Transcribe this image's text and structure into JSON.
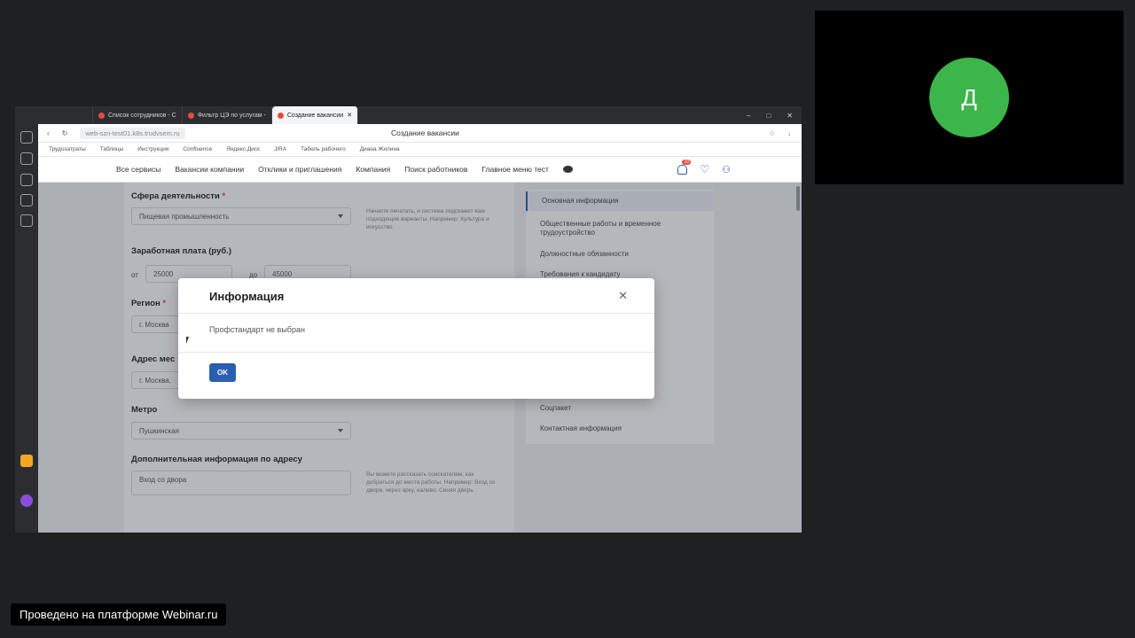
{
  "browser": {
    "tabs": [
      {
        "label": "Список сотрудников - С"
      },
      {
        "label": "Фильтр ЦЭ по услугам -"
      },
      {
        "label": "Создание вакансии",
        "active": true
      }
    ],
    "url": "web-szn-test01.k8s.trudvsem.ru",
    "page_title": "Создание вакансии",
    "bookmarks": [
      "Трудозатраты",
      "Таблицы",
      "Инструкции",
      "Confluence",
      "Яндекс.Диск",
      "JIRA",
      "Табель рабочего",
      "Диана Жилина"
    ]
  },
  "site_nav": {
    "items": [
      "Все сервисы",
      "Вакансии компании",
      "Отклики и приглашения",
      "Компания",
      "Поиск работников",
      "Главное меню тест"
    ],
    "notif_count": "10"
  },
  "form": {
    "activity_label": "Сфера деятельности",
    "activity_value": "Пищевая промышленность",
    "activity_hint": "Начните печатать, и система подскажет вам подходящие варианты. Например: Культура и искусство.",
    "salary_label": "Заработная плата (руб.)",
    "salary_from_label": "от",
    "salary_from": "25000",
    "salary_to_label": "до",
    "salary_to": "45000",
    "region_label": "Регион",
    "region_value": "г. Москва",
    "address_label": "Адрес мес",
    "address_value": "г. Москва,",
    "metro_label": "Метро",
    "metro_value": "Пушкинская",
    "extra_label": "Дополнительная информация по адресу",
    "extra_value": "Вход со двора",
    "extra_hint": "Вы можете рассказать соискателям, как добраться до места работы. Например: Вход со двора, через арку, налево. Синяя дверь"
  },
  "side_menu": {
    "items": [
      {
        "label": "Основная информация",
        "active": true
      },
      {
        "label": "Общественные работы и временное трудоустройство"
      },
      {
        "label": "Должностные обязанности"
      },
      {
        "label": "Требования к кандидату"
      },
      {
        "label": "Соцпакет"
      },
      {
        "label": "Контактная информация"
      }
    ]
  },
  "modal": {
    "title": "Информация",
    "message": "Профстандарт не выбран",
    "ok_label": "OK"
  },
  "webinar": {
    "avatar_letter": "Д",
    "avatar_color": "#3cb54a",
    "platform_label": "Проведено на платформе Webinar.ru"
  }
}
